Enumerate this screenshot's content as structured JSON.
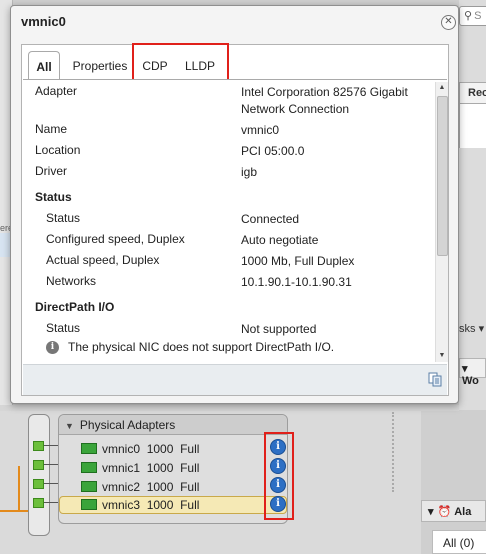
{
  "background": {
    "search_placeholder": "S",
    "rec_tab_label": "Rec",
    "left_fragment": "ere",
    "right_tasks_fragment": "sks",
    "right_work_fragment": "Wo",
    "alarms_label": "Ala",
    "all_filter": "All (0)",
    "physical_adapters": {
      "title": "Physical Adapters",
      "adapters": [
        {
          "name": "vmnic0",
          "speed": "1000",
          "duplex": "Full"
        },
        {
          "name": "vmnic1",
          "speed": "1000",
          "duplex": "Full"
        },
        {
          "name": "vmnic2",
          "speed": "1000",
          "duplex": "Full"
        },
        {
          "name": "vmnic3",
          "speed": "1000",
          "duplex": "Full"
        }
      ]
    }
  },
  "dialog": {
    "title": "vmnic0",
    "tabs": [
      {
        "label": "All",
        "active": true
      },
      {
        "label": "Properties"
      },
      {
        "label": "CDP"
      },
      {
        "label": "LLDP"
      }
    ],
    "rows": [
      {
        "label": "Adapter",
        "value": "Intel Corporation 82576 Gigabit Network Connection"
      },
      {
        "label": "Name",
        "value": "vmnic0"
      },
      {
        "label": "Location",
        "value": "PCI 05:00.0"
      },
      {
        "label": "Driver",
        "value": "igb"
      }
    ],
    "status_section": {
      "title": "Status",
      "rows": [
        {
          "label": "Status",
          "value": "Connected"
        },
        {
          "label": "Configured speed, Duplex",
          "value": "Auto negotiate"
        },
        {
          "label": "Actual speed, Duplex",
          "value": "1000 Mb, Full Duplex"
        },
        {
          "label": "Networks",
          "value": "10.1.90.1-10.1.90.31"
        }
      ]
    },
    "directpath_section": {
      "title": "DirectPath I/O",
      "rows": [
        {
          "label": "Status",
          "value": "Not supported"
        }
      ],
      "note": "The physical NIC does not support DirectPath I/O."
    }
  },
  "colors": {
    "highlight_box": "#e0201a",
    "info_icon": "#2d6fc4",
    "selected_row": "#f5e9b5",
    "port_green": "#6cbf3b",
    "uplink_orange": "#e38a1c"
  }
}
